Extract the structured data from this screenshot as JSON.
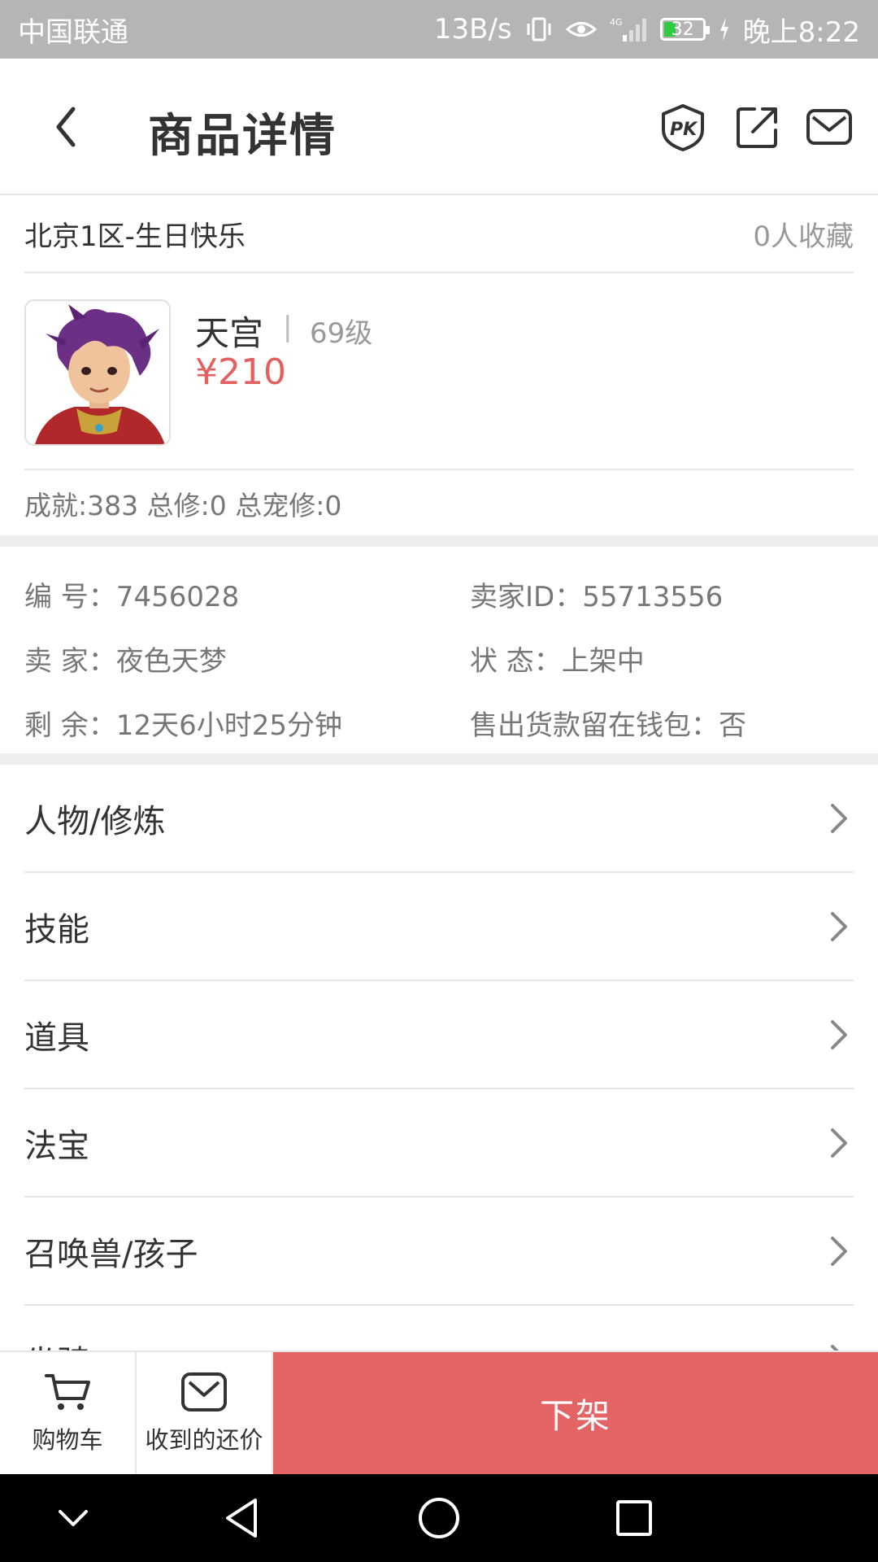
{
  "status_bar": {
    "carrier": "中国联通",
    "speed": "13B/s",
    "network": "4G",
    "battery": "32",
    "time": "晚上8:22"
  },
  "header": {
    "title": "商品详情",
    "icons": [
      "back-icon",
      "pk-icon",
      "share-icon",
      "mail-icon"
    ]
  },
  "server": {
    "name": "北京1区-生日快乐",
    "favorites": "0人收藏"
  },
  "character": {
    "name": "天宫",
    "separator": "|",
    "level": "69级",
    "price": "¥210",
    "stats": "成就:383 总修:0 总宠修:0"
  },
  "info": {
    "number": "编  号：7456028",
    "seller_id": "卖家ID：55713556",
    "seller": "卖  家：夜色天梦",
    "status": "状  态：上架中",
    "remaining": "剩  余：12天6小时25分钟",
    "wallet": "售出货款留在钱包：否"
  },
  "menu": [
    {
      "label": "人物/修炼"
    },
    {
      "label": "技能"
    },
    {
      "label": "道具"
    },
    {
      "label": "法宝"
    },
    {
      "label": "召唤兽/孩子"
    },
    {
      "label": "坐骑"
    }
  ],
  "action_bar": {
    "cart_label": "购物车",
    "offers_label": "收到的还价",
    "delist_label": "下架"
  },
  "colors": {
    "accent": "#e46466",
    "price": "#e46060",
    "status_bar": "#b5b5b5"
  }
}
